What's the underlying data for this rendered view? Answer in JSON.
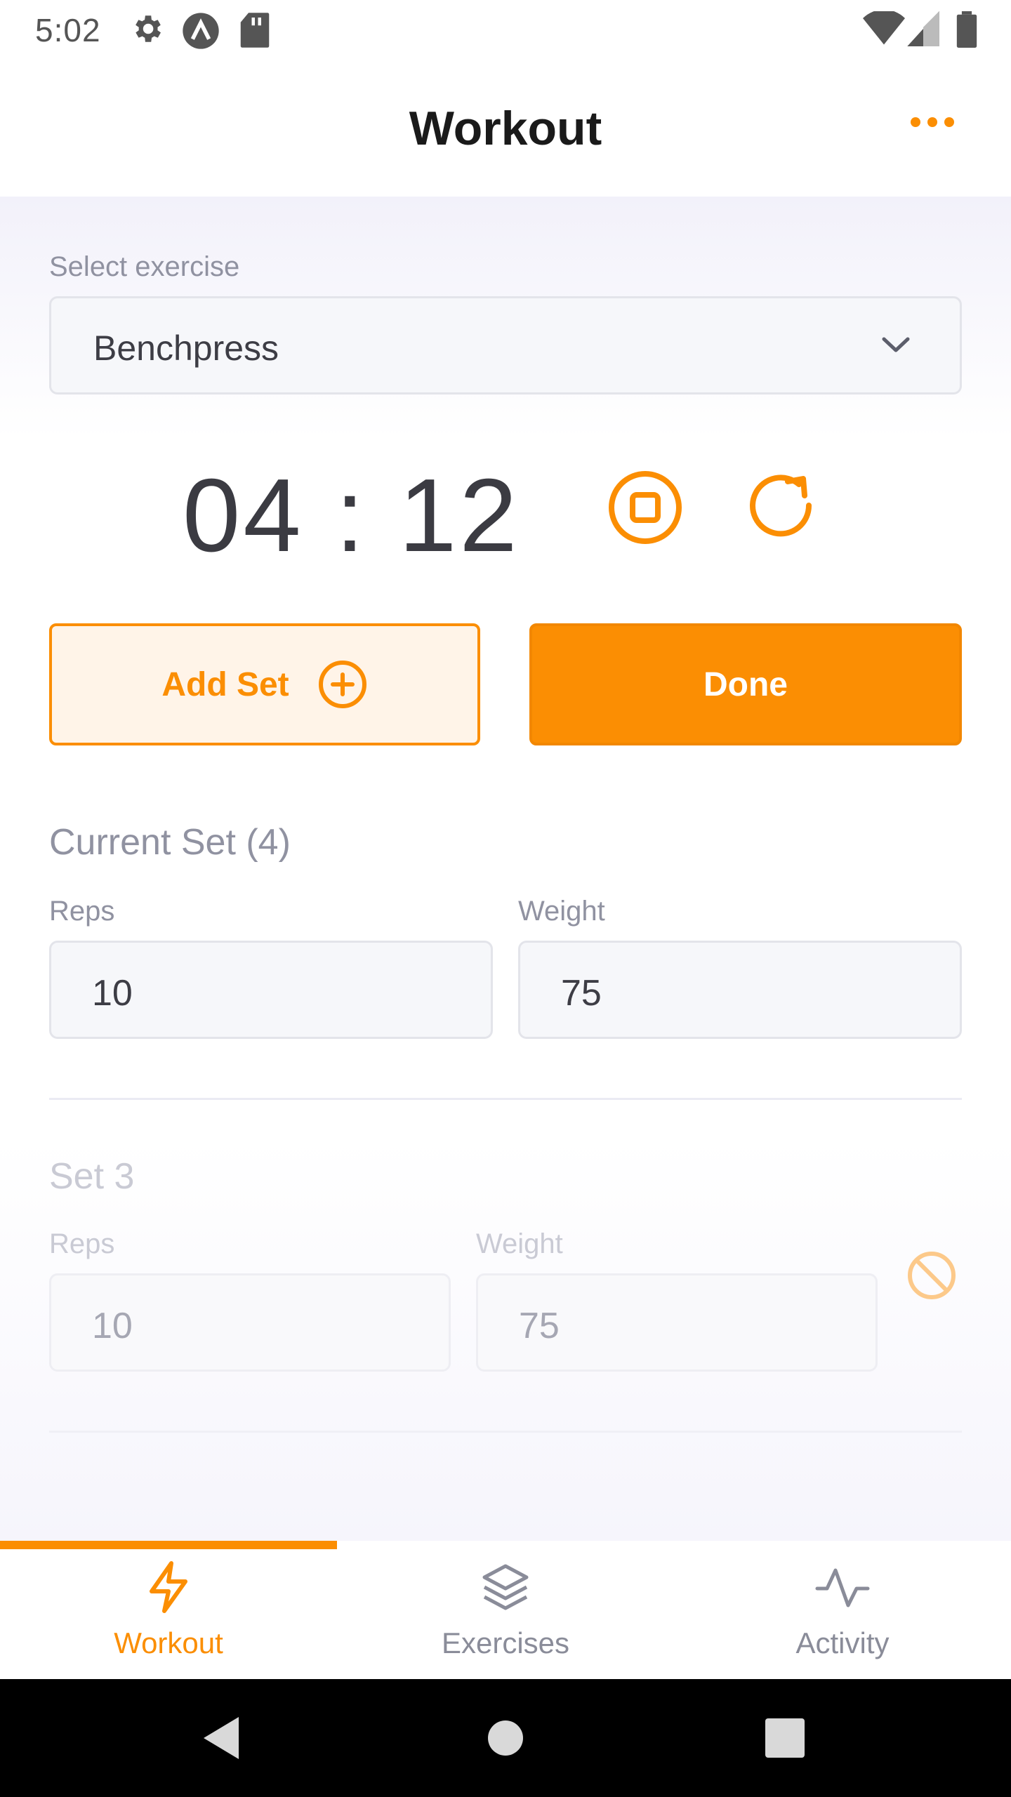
{
  "status_bar": {
    "time": "5:02"
  },
  "header": {
    "title": "Workout"
  },
  "exercise": {
    "label": "Select exercise",
    "selected": "Benchpress"
  },
  "timer": {
    "display": "04 : 12"
  },
  "actions": {
    "add_set_label": "Add Set",
    "done_label": "Done"
  },
  "current_set": {
    "title": "Current Set (4)",
    "reps_label": "Reps",
    "reps_value": "10",
    "weight_label": "Weight",
    "weight_value": "75"
  },
  "previous_sets": [
    {
      "title": "Set 3",
      "reps_label": "Reps",
      "reps_value": "10",
      "weight_label": "Weight",
      "weight_value": "75"
    }
  ],
  "tabs": [
    {
      "label": "Workout",
      "icon": "lightning-icon",
      "active": true
    },
    {
      "label": "Exercises",
      "icon": "layers-icon",
      "active": false
    },
    {
      "label": "Activity",
      "icon": "activity-icon",
      "active": false
    }
  ],
  "colors": {
    "accent": "#fb8e03",
    "accent_light": "#fff4e8",
    "muted_text": "#9092a1",
    "title_text": "#1a1a1a"
  }
}
